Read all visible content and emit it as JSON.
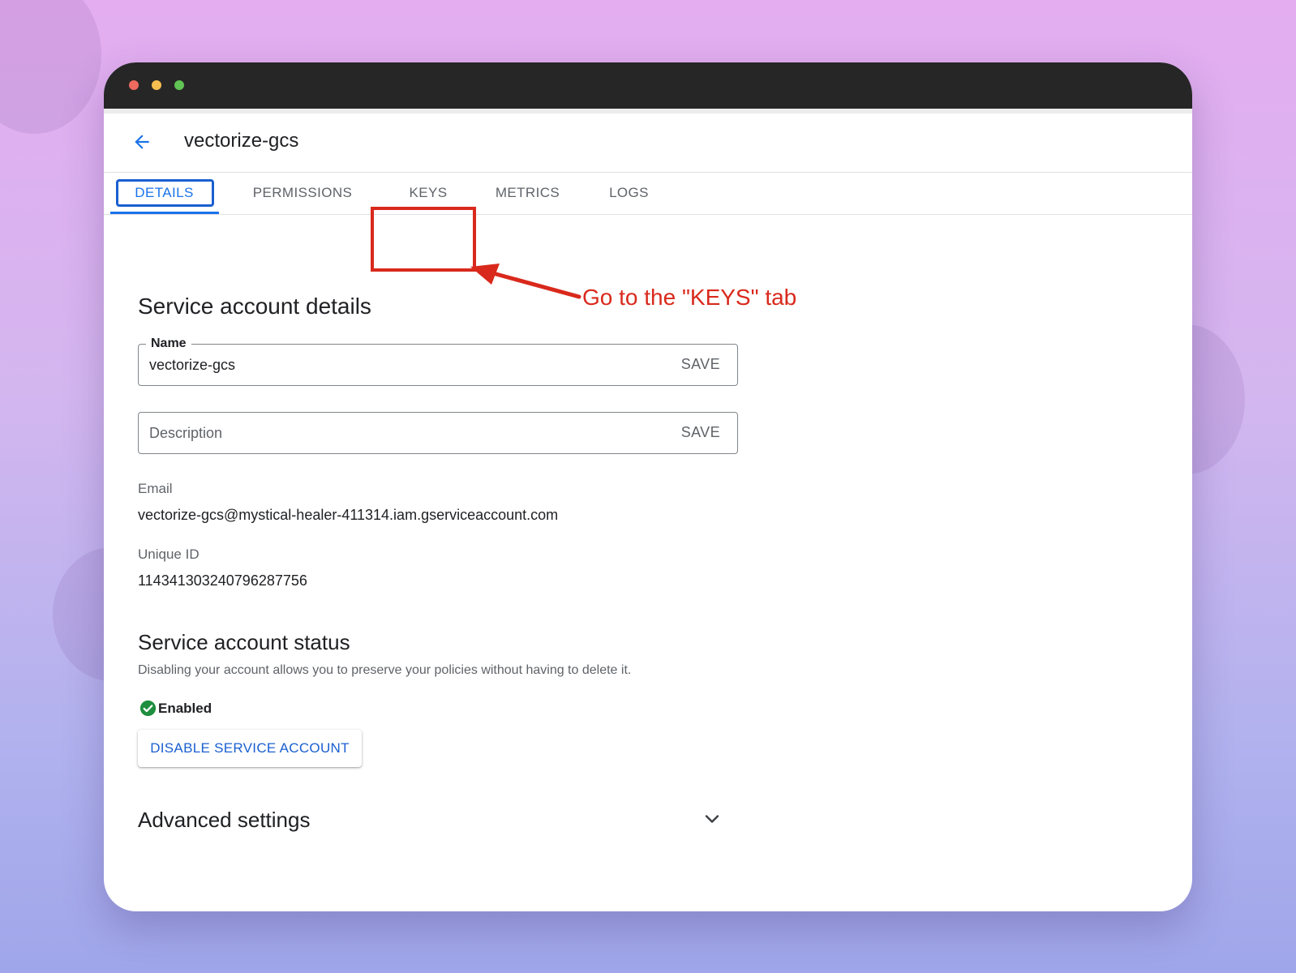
{
  "window": {
    "title": "vectorize-gcs"
  },
  "tabs": [
    {
      "label": "DETAILS",
      "active": true
    },
    {
      "label": "PERMISSIONS",
      "active": false
    },
    {
      "label": "KEYS",
      "active": false
    },
    {
      "label": "METRICS",
      "active": false
    },
    {
      "label": "LOGS",
      "active": false
    }
  ],
  "annotation": {
    "text": "Go to the \"KEYS\" tab",
    "color": "#d9291c"
  },
  "details": {
    "heading": "Service account details",
    "name_field": {
      "label": "Name",
      "value": "vectorize-gcs",
      "save_label": "SAVE"
    },
    "description_field": {
      "placeholder": "Description",
      "save_label": "SAVE"
    },
    "email": {
      "label": "Email",
      "value": "vectorize-gcs@mystical-healer-411314.iam.gserviceaccount.com"
    },
    "unique_id": {
      "label": "Unique ID",
      "value": "114341303240796287756"
    }
  },
  "status": {
    "heading": "Service account status",
    "description": "Disabling your account allows you to preserve your policies without having to delete it.",
    "state": "Enabled",
    "button_label": "DISABLE SERVICE ACCOUNT"
  },
  "advanced": {
    "heading": "Advanced settings"
  },
  "colors": {
    "accent": "#1a73e8",
    "success": "#1e8e3e",
    "titlebar": "#262626"
  },
  "icons": {
    "back": "arrow-back-icon",
    "enabled": "check-circle-icon",
    "expand": "chevron-down-icon"
  }
}
